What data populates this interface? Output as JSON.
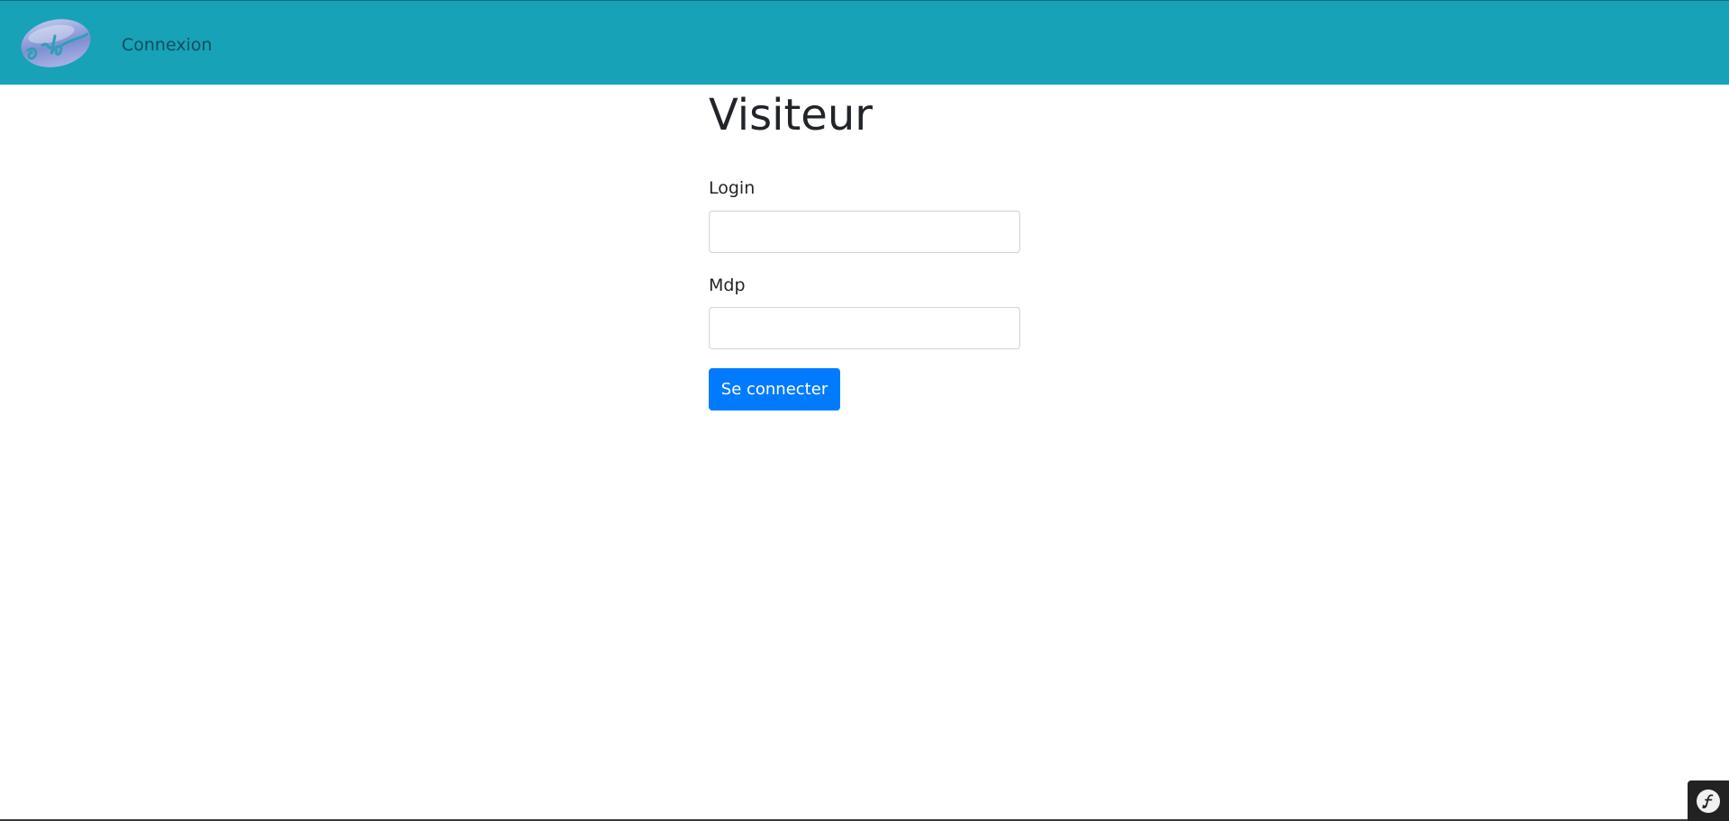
{
  "navbar": {
    "brand_logo_text": "gsb",
    "connexion_link": "Connexion",
    "background_color": "#17a2b8"
  },
  "main": {
    "title": "Visiteur",
    "login": {
      "label": "Login",
      "value": "",
      "placeholder": ""
    },
    "mdp": {
      "label": "Mdp",
      "value": "",
      "placeholder": ""
    },
    "submit_label": "Se connecter",
    "submit_color": "#007bff"
  },
  "debug_toolbar": {
    "icon": "symfony-icon",
    "logo_text": "sf"
  }
}
